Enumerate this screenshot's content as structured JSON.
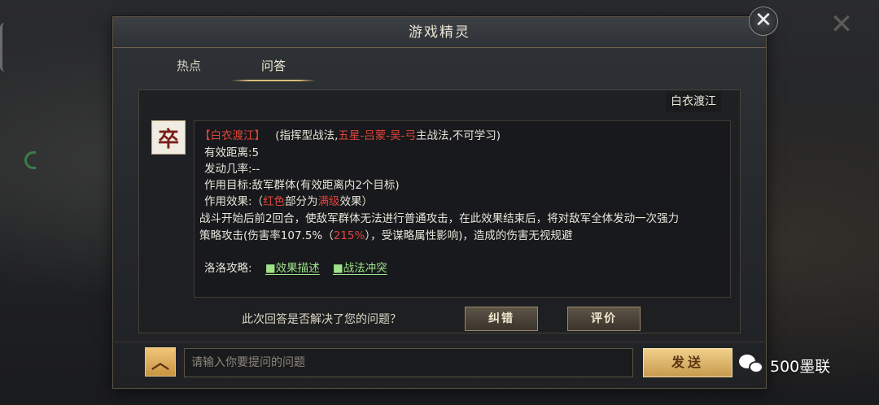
{
  "dialog": {
    "title": "游戏精灵",
    "close_symbol": "✕",
    "tabs": [
      {
        "label": "热点",
        "active": false
      },
      {
        "label": "问答",
        "active": true
      }
    ]
  },
  "skill": {
    "tag": "白衣渡江",
    "icon_char": "卒",
    "name_bracket": "【白衣渡江】",
    "type_prefix": "(指挥型战法,",
    "type_red": "五星-吕蒙-吴-弓",
    "type_suffix": "主战法,不可学习)",
    "range": "有效距离:5",
    "chance": "发动几率:--",
    "target": "作用目标:敌军群体(有效距离内2个目标)",
    "effect_prefix": "作用效果:（",
    "effect_red1": "红色",
    "effect_mid": "部分为",
    "effect_red2": "满级",
    "effect_suffix": "效果）",
    "desc_line1": "战斗开始后前2回合，使敌军群体无法进行普通攻击，在此效果结束后，将对敌军全体发动一次强力",
    "desc_line2_prefix": "策略攻击(伤害率107.5%（",
    "desc_line2_red": "215%",
    "desc_line2_suffix": "），受谋略属性影响)，造成的伤害无视规避",
    "guide_label": "洛洛攻略:",
    "guide_links": [
      "■效果描述",
      "■战法冲突"
    ]
  },
  "feedback": {
    "question": "此次回答是否解决了您的问题？",
    "correct_button": "纠错",
    "rate_button": "评价"
  },
  "input": {
    "expand_symbol": "︿",
    "placeholder": "请输入你要提问的问题",
    "value": "",
    "send_button": "发送"
  },
  "watermark": {
    "text": "500墨联"
  },
  "colors": {
    "highlight_red": "#e0443a",
    "link_green": "#9fe28a",
    "gold_button": "#d9ad62"
  }
}
